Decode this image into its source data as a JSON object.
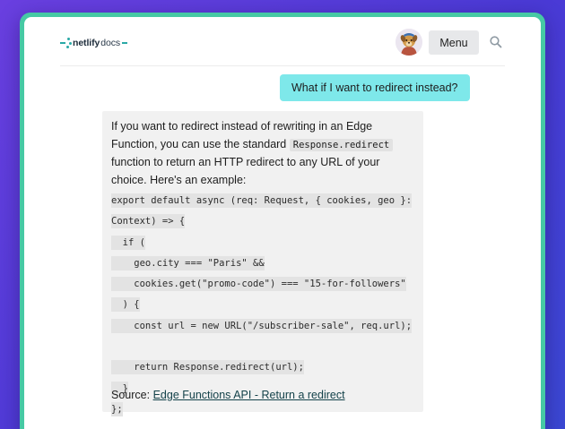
{
  "header": {
    "logo_name": "netlify",
    "logo_suffix": "docs",
    "menu_label": "Menu"
  },
  "conversation": {
    "user_message": "What if I want to redirect instead?",
    "reply_intro_before_code": "If you want to redirect instead of rewriting in an Edge Function, you can use the standard",
    "reply_inline_code": "Response.redirect",
    "reply_intro_after_code": "function to return an HTTP redirect to any URL of your choice. Here's an example:",
    "code_lines": [
      "export default async (req: Request, { cookies, geo }:",
      "Context) => {",
      "  if (",
      "    geo.city === \"Paris\" &&",
      "    cookies.get(\"promo-code\") === \"15-for-followers\"",
      "  ) {",
      "    const url = new URL(\"/subscriber-sale\", req.url);",
      "",
      "    return Response.redirect(url);",
      "  }",
      "};"
    ],
    "source_label": "Source:",
    "source_link": "Edge Functions API - Return a redirect"
  },
  "colors": {
    "background_gradient_start": "#6a3fe0",
    "background_gradient_end": "#3b48d4",
    "frame": "#46c9a4",
    "user_bubble": "#7ee8ea",
    "reply_background": "#f1f1f1",
    "link": "#14424a",
    "brand_teal": "#2aa9a6"
  },
  "icons": {
    "avatar": "dog-avatar-icon",
    "search": "search-icon"
  }
}
